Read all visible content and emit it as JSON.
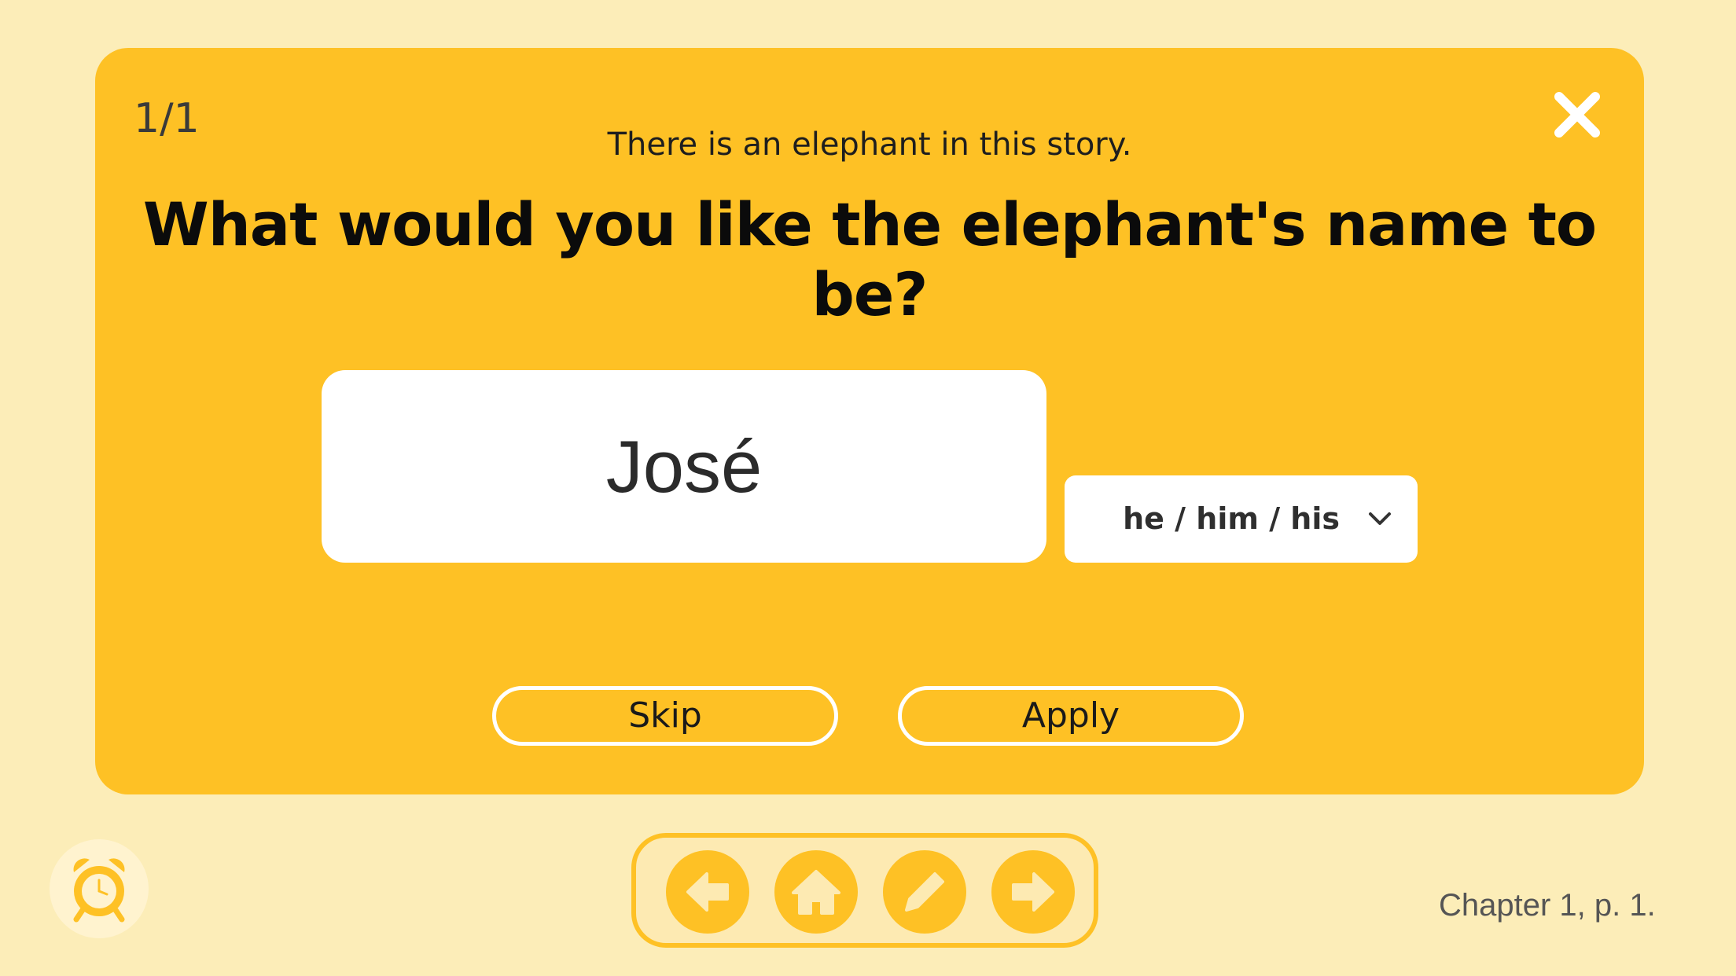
{
  "card": {
    "counter": "1/1",
    "subtitle": "There is an elephant in this story.",
    "question": "What would you like the elephant's name to be?",
    "close_icon": "close-icon"
  },
  "name_field": {
    "value": "José"
  },
  "pronoun_select": {
    "selected": "he / him / his",
    "icon": "chevron-down-icon"
  },
  "buttons": {
    "skip_label": "Skip",
    "apply_label": "Apply"
  },
  "toolbar": {
    "alarm_icon": "alarm-clock-icon",
    "back_icon": "arrow-left-icon",
    "home_icon": "home-icon",
    "edit_icon": "pencil-icon",
    "forward_icon": "arrow-right-icon"
  },
  "footer": {
    "page_label": "Chapter 1, p. 1."
  },
  "colors": {
    "background": "#fcedb8",
    "card": "#fec125",
    "white": "#ffffff"
  }
}
